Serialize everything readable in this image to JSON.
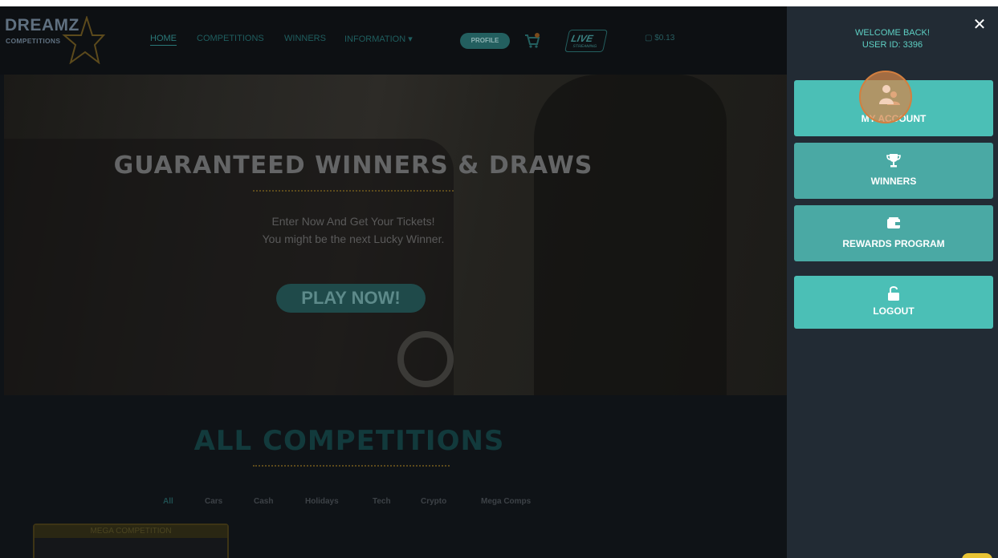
{
  "site": {
    "logo_line1": "DREAMZ",
    "logo_line2": "COMPETITIONS"
  },
  "nav": {
    "items": [
      "HOME",
      "COMPETITIONS",
      "WINNERS",
      "INFORMATION ▾"
    ],
    "profile_label": "PROFILE",
    "live_label": "LIVE",
    "live_sub": "STREAMING",
    "wallet": "$0.13"
  },
  "hero": {
    "title": "GUARANTEED WINNERS & DRAWS",
    "line1": "Enter Now And Get Your Tickets!",
    "line2": "You might be the next Lucky Winner.",
    "cta": "PLAY NOW!"
  },
  "competitions": {
    "title": "ALL COMPETITIONS",
    "categories": [
      "All",
      "Cars",
      "Cash",
      "Holidays",
      "Tech",
      "Crypto",
      "Mega Comps"
    ],
    "card_banner": "MEGA COMPETITION"
  },
  "sidebar": {
    "welcome": "WELCOME BACK!",
    "user_id": "USER ID: 3396",
    "close": "✕",
    "buttons": [
      {
        "label": "MY ACCOUNT",
        "icon": "user-icon"
      },
      {
        "label": "WINNERS",
        "icon": "trophy-icon"
      },
      {
        "label": "REWARDS PROGRAM",
        "icon": "wallet-icon"
      },
      {
        "label": "LOGOUT",
        "icon": "unlock-icon"
      }
    ]
  },
  "colors": {
    "sidebar_bg": "#222b34",
    "button_teal": "#4bbfb6",
    "accent_orange": "#d68548"
  }
}
